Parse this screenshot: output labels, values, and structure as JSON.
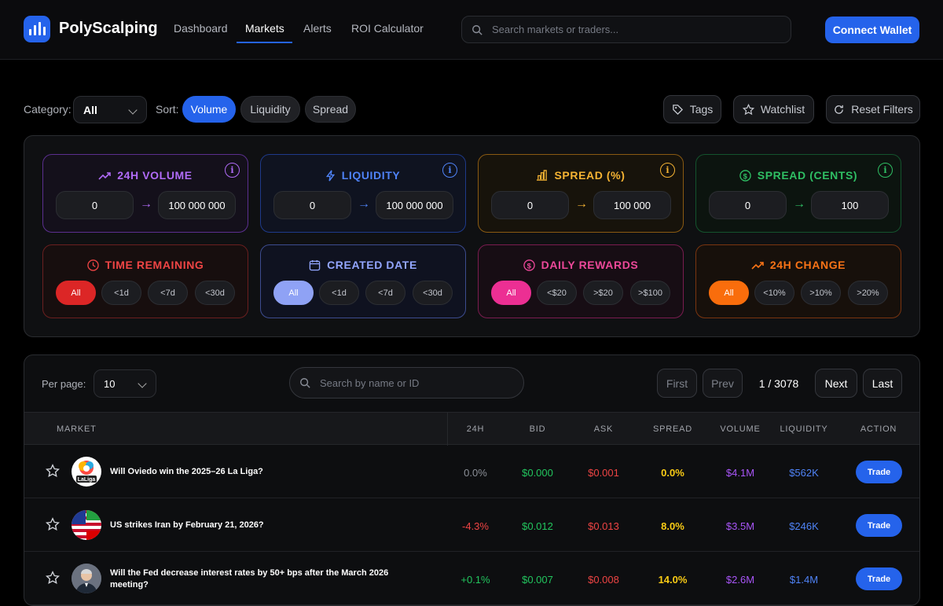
{
  "app": {
    "brand": "PolyScalping"
  },
  "nav": {
    "items": [
      "Dashboard",
      "Markets",
      "Alerts",
      "ROI Calculator"
    ],
    "active": "Markets"
  },
  "header": {
    "search_placeholder": "Search markets or traders...",
    "connect_label": "Connect Wallet"
  },
  "toolbar": {
    "category_label": "Category:",
    "category_value": "All",
    "sort_label": "Sort:",
    "sort_options": [
      "Volume",
      "Liquidity",
      "Spread"
    ],
    "sort_active": "Volume",
    "tags_label": "Tags",
    "watchlist_label": "Watchlist",
    "reset_label": "Reset Filters"
  },
  "range_filters": [
    {
      "title": "24H VOLUME",
      "min": "0",
      "max": "100 000 000",
      "color": "#a855f7"
    },
    {
      "title": "LIQUIDITY",
      "min": "0",
      "max": "100 000 000",
      "color": "#3b82f6"
    },
    {
      "title": "SPREAD (%)",
      "min": "0",
      "max": "100 000",
      "color": "#f59e0b"
    },
    {
      "title": "SPREAD (CENTS)",
      "min": "0",
      "max": "100",
      "color": "#22c55e"
    }
  ],
  "chip_filters": [
    {
      "title": "TIME REMAINING",
      "options": [
        "All",
        "<1d",
        "<7d",
        "<30d"
      ],
      "color": "#ef4444"
    },
    {
      "title": "CREATED DATE",
      "options": [
        "All",
        "<1d",
        "<7d",
        "<30d"
      ],
      "color": "#93a6ff"
    },
    {
      "title": "DAILY REWARDS",
      "options": [
        "All",
        "<$20",
        ">$20",
        ">$100"
      ],
      "color": "#ec4899"
    },
    {
      "title": "24H CHANGE",
      "options": [
        "All",
        "<10%",
        ">10%",
        ">20%"
      ],
      "color": "#f97316"
    }
  ],
  "table_controls": {
    "per_page_label": "Per page:",
    "per_page_value": "10",
    "search_placeholder": "Search by name or ID",
    "first": "First",
    "prev": "Prev",
    "page": "1 / 3078",
    "next": "Next",
    "last": "Last"
  },
  "columns": [
    "MARKET",
    "24H",
    "BID",
    "ASK",
    "SPREAD",
    "VOLUME",
    "LIQUIDITY",
    "ACTION"
  ],
  "rows": [
    {
      "name": "Will Oviedo win the 2025–26 La Liga?",
      "change": "0.0%",
      "bid": "$0.000",
      "ask": "$0.001",
      "spread": "0.0%",
      "volume": "$4.1M",
      "liquidity": "$562K",
      "action": "Trade",
      "avatar_text": "LaLiga"
    },
    {
      "name": "US strikes Iran by February 21, 2026?",
      "change": "-4.3%",
      "bid": "$0.012",
      "ask": "$0.013",
      "spread": "8.0%",
      "volume": "$3.5M",
      "liquidity": "$246K",
      "action": "Trade",
      "avatar_text": ""
    },
    {
      "name": "Will the Fed decrease interest rates by 50+ bps after the March 2026 meeting?",
      "change": "+0.1%",
      "bid": "$0.007",
      "ask": "$0.008",
      "spread": "14.0%",
      "volume": "$2.6M",
      "liquidity": "$1.4M",
      "action": "Trade",
      "avatar_text": ""
    }
  ],
  "colors": {
    "accent": "#2563eb",
    "bid": "#22c55e",
    "ask": "#ef4444",
    "spread": "#facc15",
    "volume": "#a855f7",
    "liquidity": "#3b82f6"
  }
}
